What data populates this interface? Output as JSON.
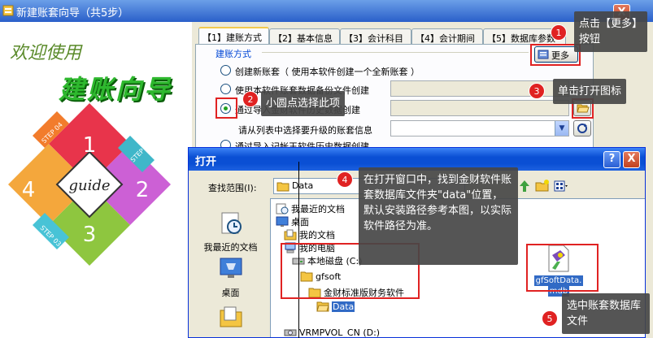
{
  "wizard": {
    "title": "新建账套向导（共5步）",
    "welcome": "欢迎使用",
    "name": "建账向导",
    "diamond": {
      "center": "guide",
      "num1": "1",
      "num2": "2",
      "num3": "3",
      "num4": "4",
      "step1": "STEP 01",
      "step3": "STEP 03",
      "step4": "STEP 04"
    },
    "close": "X",
    "tabs": [
      "【1】建账方式",
      "【2】基本信息",
      "【3】会计科目",
      "【4】会计期间",
      "【5】数据库参数"
    ],
    "group_label": "建账方式",
    "more_button": "更多",
    "options": {
      "opt1": "创建新账套（ 使用本软件创建一个全新账套 ）",
      "opt2": "使用本软件账套数据备份文件创建",
      "opt3": "通过导入金财软件历史数据创建",
      "sub_label": "请从列表中选择要升级的账套信息",
      "opt4": "通过导入记帐王软件历史数据创建"
    }
  },
  "dialog": {
    "title": "打开",
    "help": "?",
    "close": "X",
    "lookin_label": "查找范围(I):",
    "lookin_value": "Data",
    "places": [
      "我最近的文档",
      "桌面"
    ],
    "tree": {
      "recent": "我最近的文档",
      "desktop": "桌面",
      "mydocs": "我的文档",
      "mycomputer": "我的电脑",
      "localdisk": "本地磁盘 (C:)",
      "gfsoft": "gfsoft",
      "finance": "金财标准版财务软件",
      "data": "Data",
      "vrmpvol": "VRMPVOL_CN (D:)"
    },
    "file": {
      "name_line1": "gfSoftData.",
      "name_line2": "mdb"
    }
  },
  "annotations": {
    "n1": "1",
    "n2": "2",
    "n3": "3",
    "n4": "4",
    "n5": "5",
    "c1": "点击【更多】按钮",
    "c2": "小圆点选择此项",
    "c3": "单击打开图标",
    "c4": "在打开窗口中，找到金财软件账套数据库文件夹\"data\"位置，默认安装路径参考本图，以实际软件路径为准。",
    "c5": "选中账套数据库文件"
  },
  "colors": {
    "title_blue": "#0a4fd4",
    "annotation_red": "#e02222",
    "callout_bg": "#464646",
    "selection": "#316ac5"
  }
}
